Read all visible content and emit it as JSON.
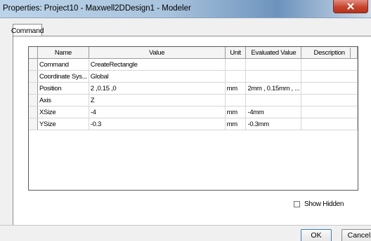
{
  "window": {
    "title": "Properties: Project10 - Maxwell2DDesign1 - Modeler",
    "close_label": "x"
  },
  "tabs": [
    {
      "label": "Command"
    }
  ],
  "table": {
    "columns": [
      "Name",
      "Value",
      "Unit",
      "Evaluated Value",
      "Description"
    ],
    "rows": [
      {
        "name": "Command",
        "value": "CreateRectangle",
        "unit": "",
        "evaluated": "",
        "description": ""
      },
      {
        "name": "Coordinate Sys...",
        "value": "Global",
        "unit": "",
        "evaluated": "",
        "description": ""
      },
      {
        "name": "Position",
        "value": "2 ,0.15 ,0",
        "unit": "mm",
        "evaluated": "2mm , 0.15mm , ...",
        "description": ""
      },
      {
        "name": "Axis",
        "value": "Z",
        "unit": "",
        "evaluated": "",
        "description": ""
      },
      {
        "name": "XSize",
        "value": "-4",
        "unit": "mm",
        "evaluated": "-4mm",
        "description": ""
      },
      {
        "name": "YSize",
        "value": "-0.3",
        "unit": "mm",
        "evaluated": "-0.3mm",
        "description": ""
      }
    ]
  },
  "show_hidden": {
    "label": "Show Hidden",
    "checked": false
  },
  "buttons": {
    "ok": "OK",
    "cancel": "Cancel"
  }
}
